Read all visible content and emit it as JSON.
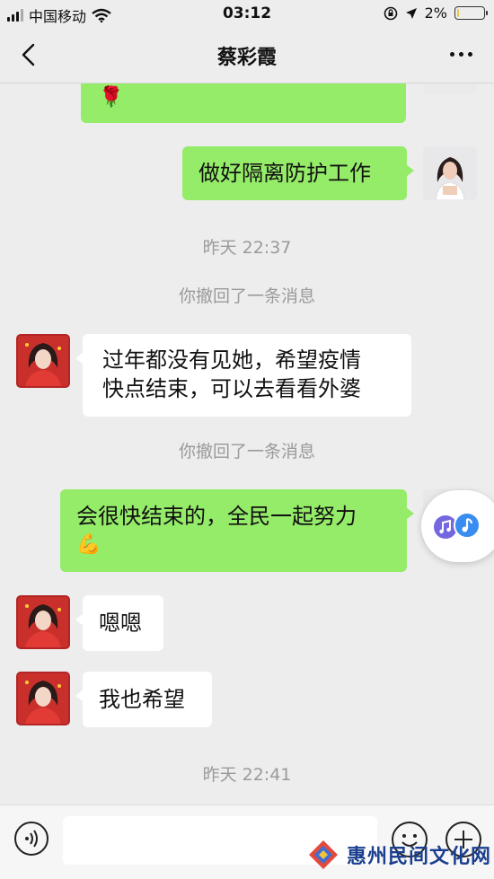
{
  "status_bar": {
    "carrier": "中国移动",
    "time": "03:12",
    "battery_percent": "2%",
    "battery_level": 0.02
  },
  "header": {
    "title": "蔡彩霞",
    "back_icon": "chevron-left-icon",
    "more_icon": "more-dots-icon"
  },
  "messages": {
    "m1_emoji": "🌹",
    "m2_text": "做好隔离防护工作",
    "time1": "昨天 22:37",
    "recall1": "你撤回了一条消息",
    "m3_line1": "过年都没有见她，希望疫情",
    "m3_line2": "快点结束，可以去看看外婆",
    "recall2": "你撤回了一条消息",
    "m4_text": "会很快结束的，全民一起努力",
    "m4_emoji": "💪",
    "m5_text": "嗯嗯",
    "m6_text": "我也希望",
    "time2": "昨天 22:41"
  },
  "input_bar": {
    "value": "",
    "voice_icon": "voice-icon",
    "emoji_icon": "emoji-icon",
    "plus_icon": "plus-icon"
  },
  "watermark": {
    "text": "惠州民间文化网"
  },
  "colors": {
    "background": "#ededed",
    "bubble_sent": "#95ec69",
    "bubble_received": "#ffffff",
    "system_text": "#9a9a9a",
    "watermark": "#1b3f8f"
  }
}
